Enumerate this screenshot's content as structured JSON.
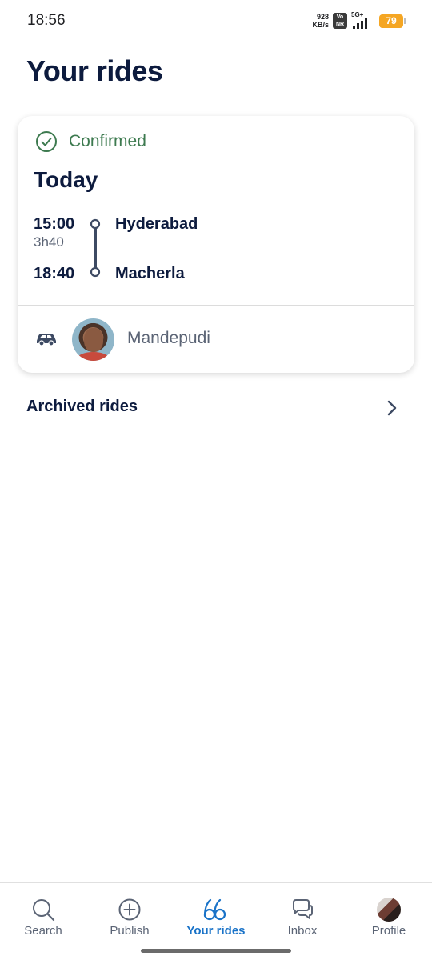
{
  "status_bar": {
    "time": "18:56",
    "net_speed_value": "928",
    "net_speed_unit": "KB/s",
    "volte_top": "Vo",
    "volte_bottom": "NR",
    "network": "5G+",
    "battery": "79"
  },
  "page": {
    "title": "Your rides"
  },
  "ride": {
    "status": "Confirmed",
    "date": "Today",
    "departure_time": "15:00",
    "duration": "3h40",
    "arrival_time": "18:40",
    "from": "Hyderabad",
    "to": "Macherla",
    "driver_name": "Mandepudi"
  },
  "archived": {
    "label": "Archived rides"
  },
  "nav": {
    "items": [
      {
        "label": "Search",
        "icon": "search-icon",
        "active": false
      },
      {
        "label": "Publish",
        "icon": "plus-circle-icon",
        "active": false
      },
      {
        "label": "Your rides",
        "icon": "rides-icon",
        "active": true
      },
      {
        "label": "Inbox",
        "icon": "chat-icon",
        "active": false
      },
      {
        "label": "Profile",
        "icon": "profile-avatar",
        "active": false
      }
    ]
  },
  "colors": {
    "primary_text": "#0d1b3e",
    "secondary_text": "#5b6475",
    "confirmed_green": "#3d7a4f",
    "active_blue": "#1a73c8",
    "battery": "#f5a623"
  }
}
